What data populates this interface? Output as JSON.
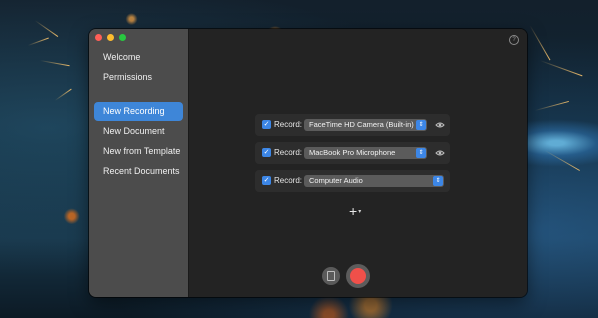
{
  "sidebar": {
    "items": [
      {
        "label": "Welcome",
        "active": false
      },
      {
        "label": "Permissions",
        "active": false
      },
      {
        "label": "New Recording",
        "active": true
      },
      {
        "label": "New Document",
        "active": false
      },
      {
        "label": "New from Template",
        "active": false
      },
      {
        "label": "Recent Documents",
        "active": false
      }
    ]
  },
  "main": {
    "help_icon": "question-circle-icon",
    "recordings": [
      {
        "checked": true,
        "label": "Record:",
        "source": "FaceTime HD Camera (Built-in)",
        "icon": "eye-icon"
      },
      {
        "checked": true,
        "label": "Record:",
        "source": "MacBook Pro Microphone",
        "icon": "eye-icon"
      },
      {
        "checked": true,
        "label": "Record:",
        "source": "Computer Audio"
      }
    ],
    "add_button": "+",
    "bottom_controls": [
      "filmstrip-icon",
      "record-icon"
    ]
  },
  "colors": {
    "accent": "#3e86d8",
    "record": "#f0504a",
    "sidebar_bg": "#4c4c4c",
    "main_bg": "#232323"
  }
}
